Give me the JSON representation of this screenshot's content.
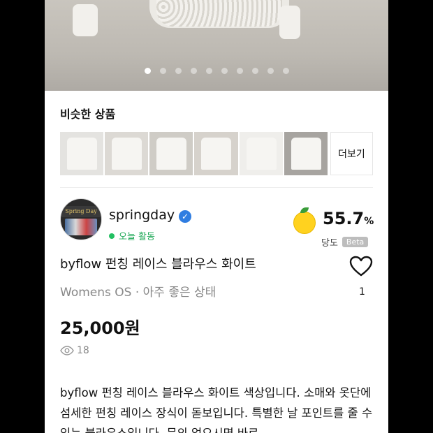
{
  "hero": {
    "slide_count": 10,
    "active_index": 0
  },
  "similar": {
    "title": "비슷한 상품",
    "more_label": "더보기",
    "thumbnail_count": 7
  },
  "seller": {
    "name": "springday",
    "avatar_sign": "Spring Day",
    "verified_icon": "check-badge-icon",
    "activity": "오늘 활동",
    "activity_color": "#23c062",
    "sweetness_value": "55.7",
    "sweetness_unit": "%",
    "sweetness_label": "당도",
    "beta_label": "Beta"
  },
  "product": {
    "title": "byflow 펀칭 레이스 블라우스 화이트",
    "subtitle": "Womens OS · 아주 좋은 상태",
    "price": "25,000원",
    "views": "18",
    "likes": "1",
    "description": "byflow 펀칭 레이스 블라우스 화이트 색상입니다. 소매와 옷단에 섬세한 펀칭 레이스 장식이 돋보입니다. 특별한 날 포인트를 줄 수 있는 블라우스입니다. 문의 없으시면 바로"
  }
}
